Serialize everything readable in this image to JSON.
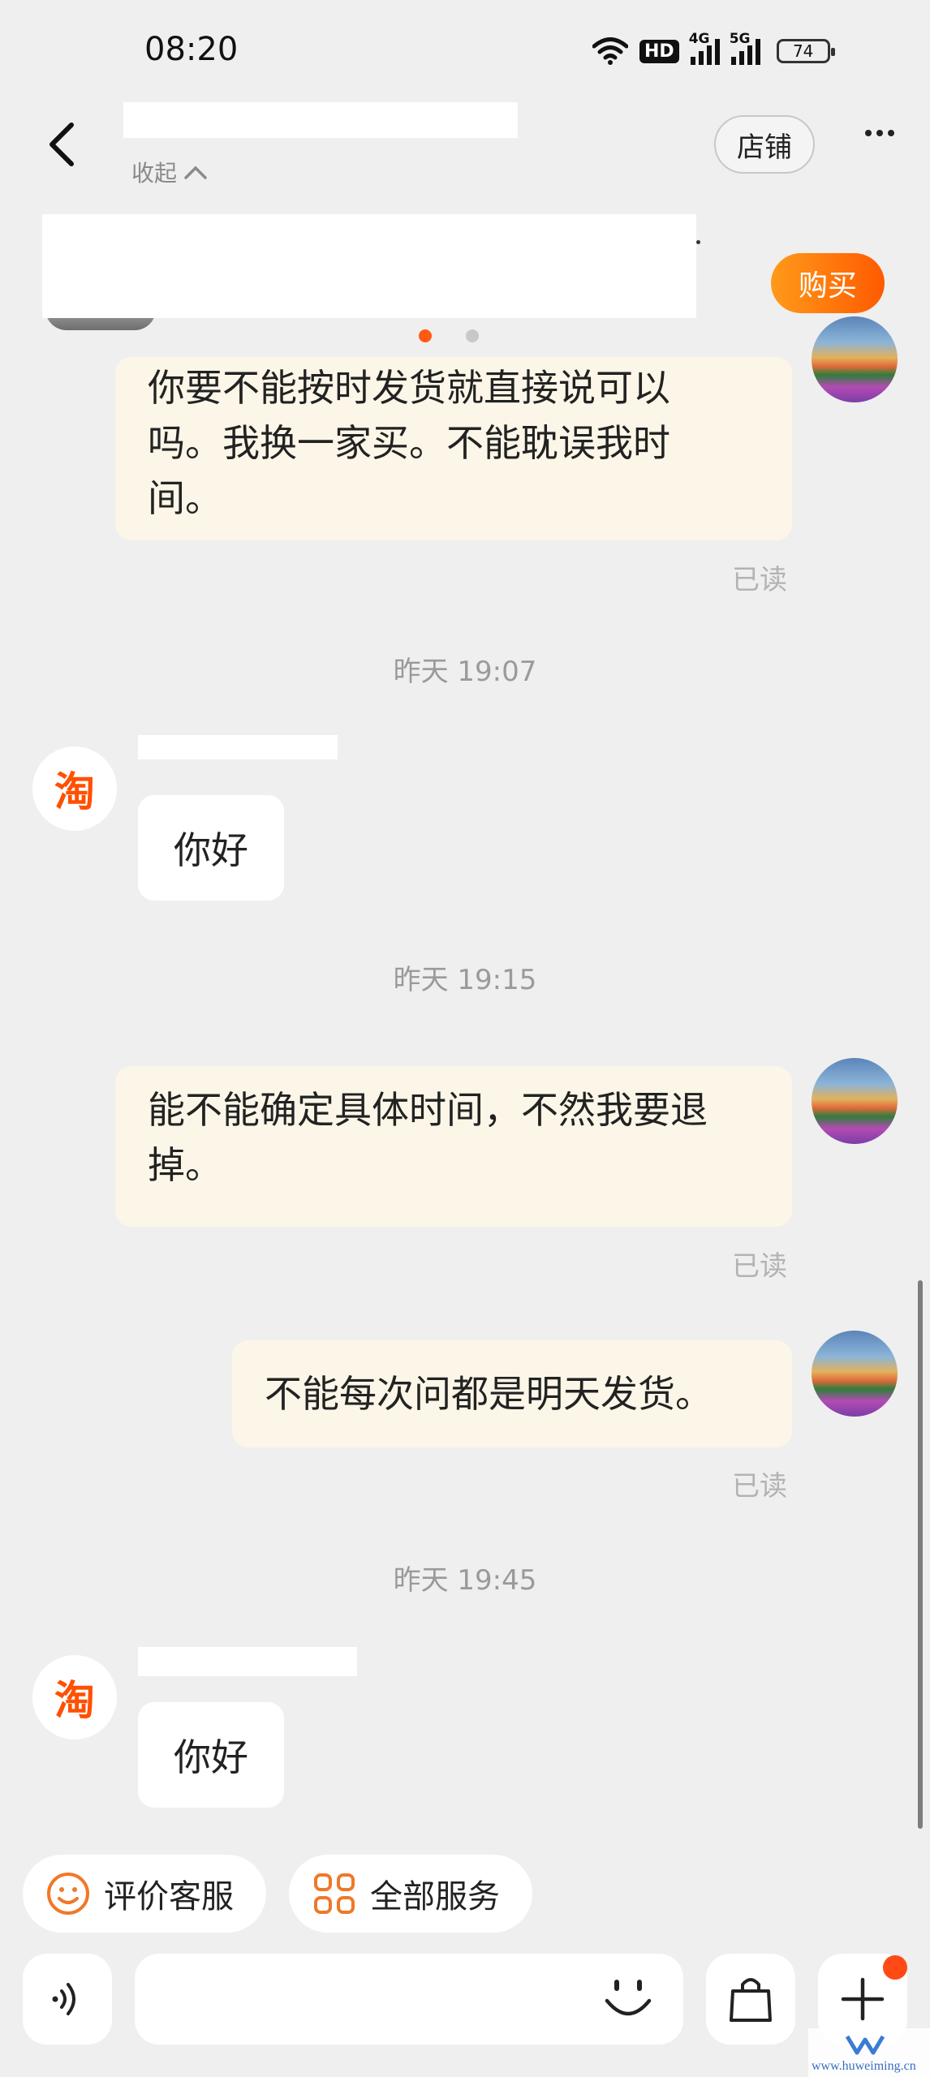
{
  "status_bar": {
    "time": "08:20",
    "hd_label": "HD",
    "net1_label": "4G",
    "net2_label": "5G",
    "battery": "74"
  },
  "header": {
    "shop_button": "店铺",
    "collapse_label": "收起",
    "buy_button": "购买"
  },
  "messages": {
    "m1_text": "你要不能按时发货就直接说可以吗。我换一家买。不能耽误我时间。",
    "m1_status": "已读",
    "t1": "昨天 19:07",
    "m2_text": "你好",
    "t2": "昨天 19:15",
    "m3_text": "能不能确定具体时间，不然我要退掉。",
    "m3_status": "已读",
    "m4_text": "不能每次问都是明天发货。",
    "m4_status": "已读",
    "t3": "昨天 19:45",
    "m5_text": "你好",
    "taobao_avatar": "淘"
  },
  "quick_actions": {
    "rate_service": "评价客服",
    "all_services": "全部服务"
  },
  "input": {
    "placeholder": ""
  },
  "watermark": "www.huweiming.cn"
}
